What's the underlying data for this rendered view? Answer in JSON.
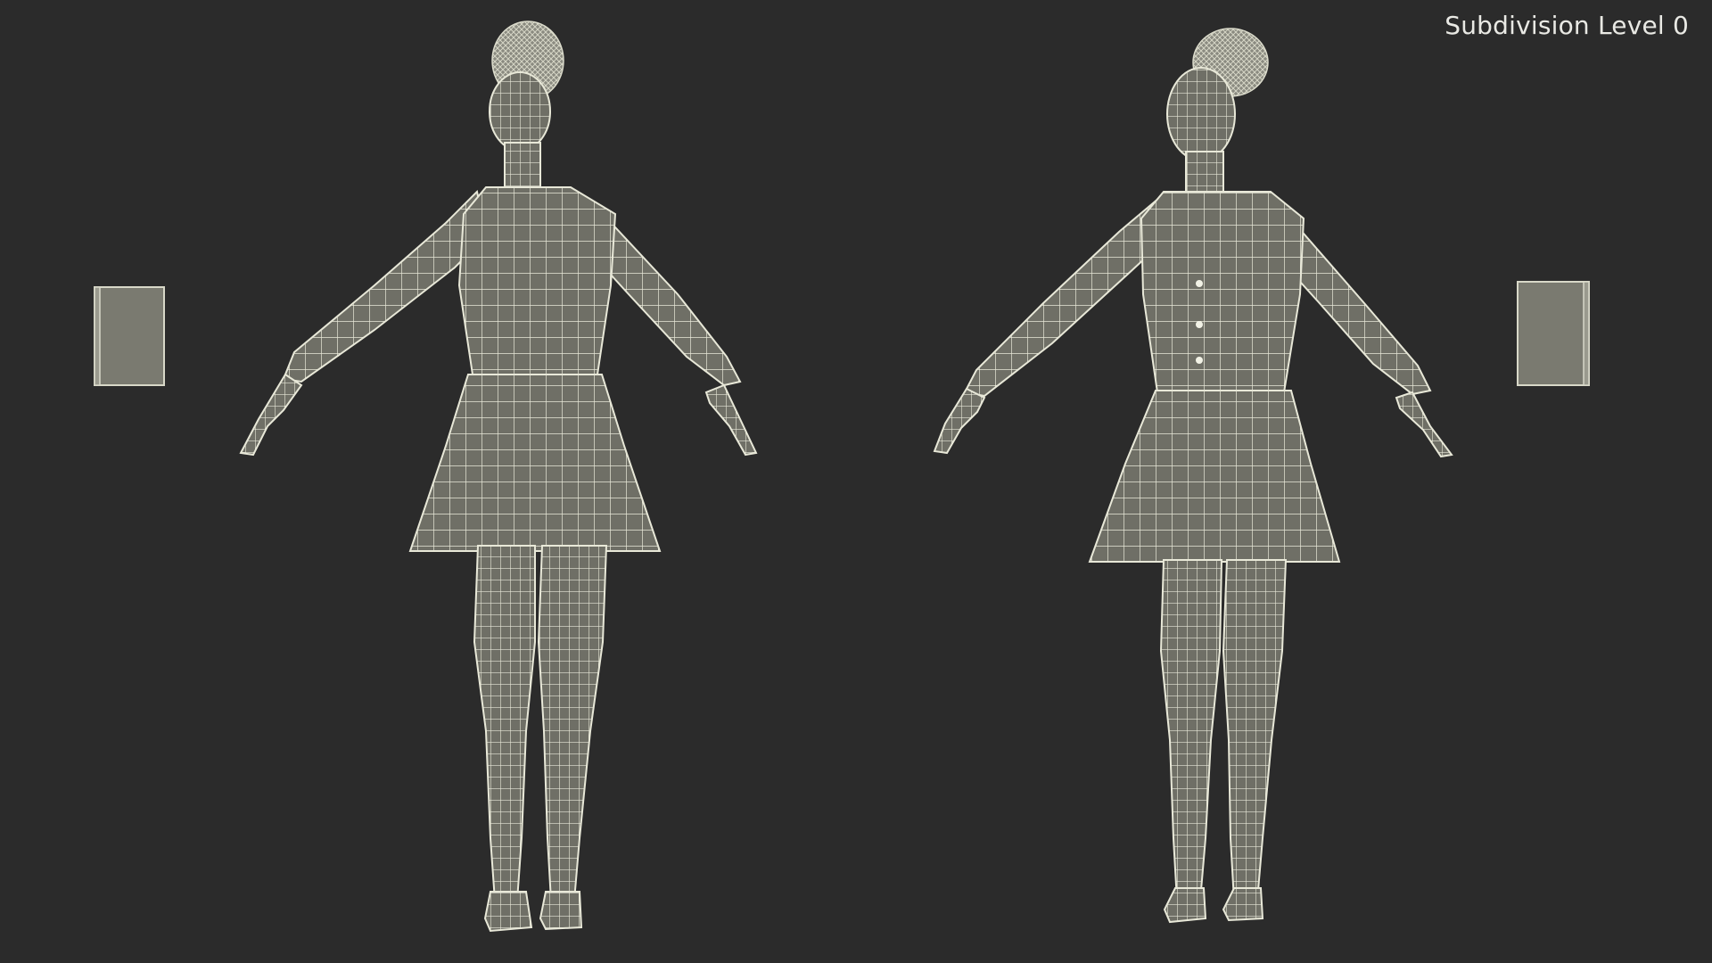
{
  "viewport": {
    "label": "Subdivision Level 0",
    "background": "#2b2b2b",
    "wire_color": "#e8e8d8",
    "surface_color": "#6f6f66"
  },
  "scene": {
    "figures": [
      {
        "name": "back-view-figure"
      },
      {
        "name": "front-view-figure"
      }
    ],
    "props": [
      {
        "name": "book-left"
      },
      {
        "name": "book-right"
      }
    ]
  }
}
